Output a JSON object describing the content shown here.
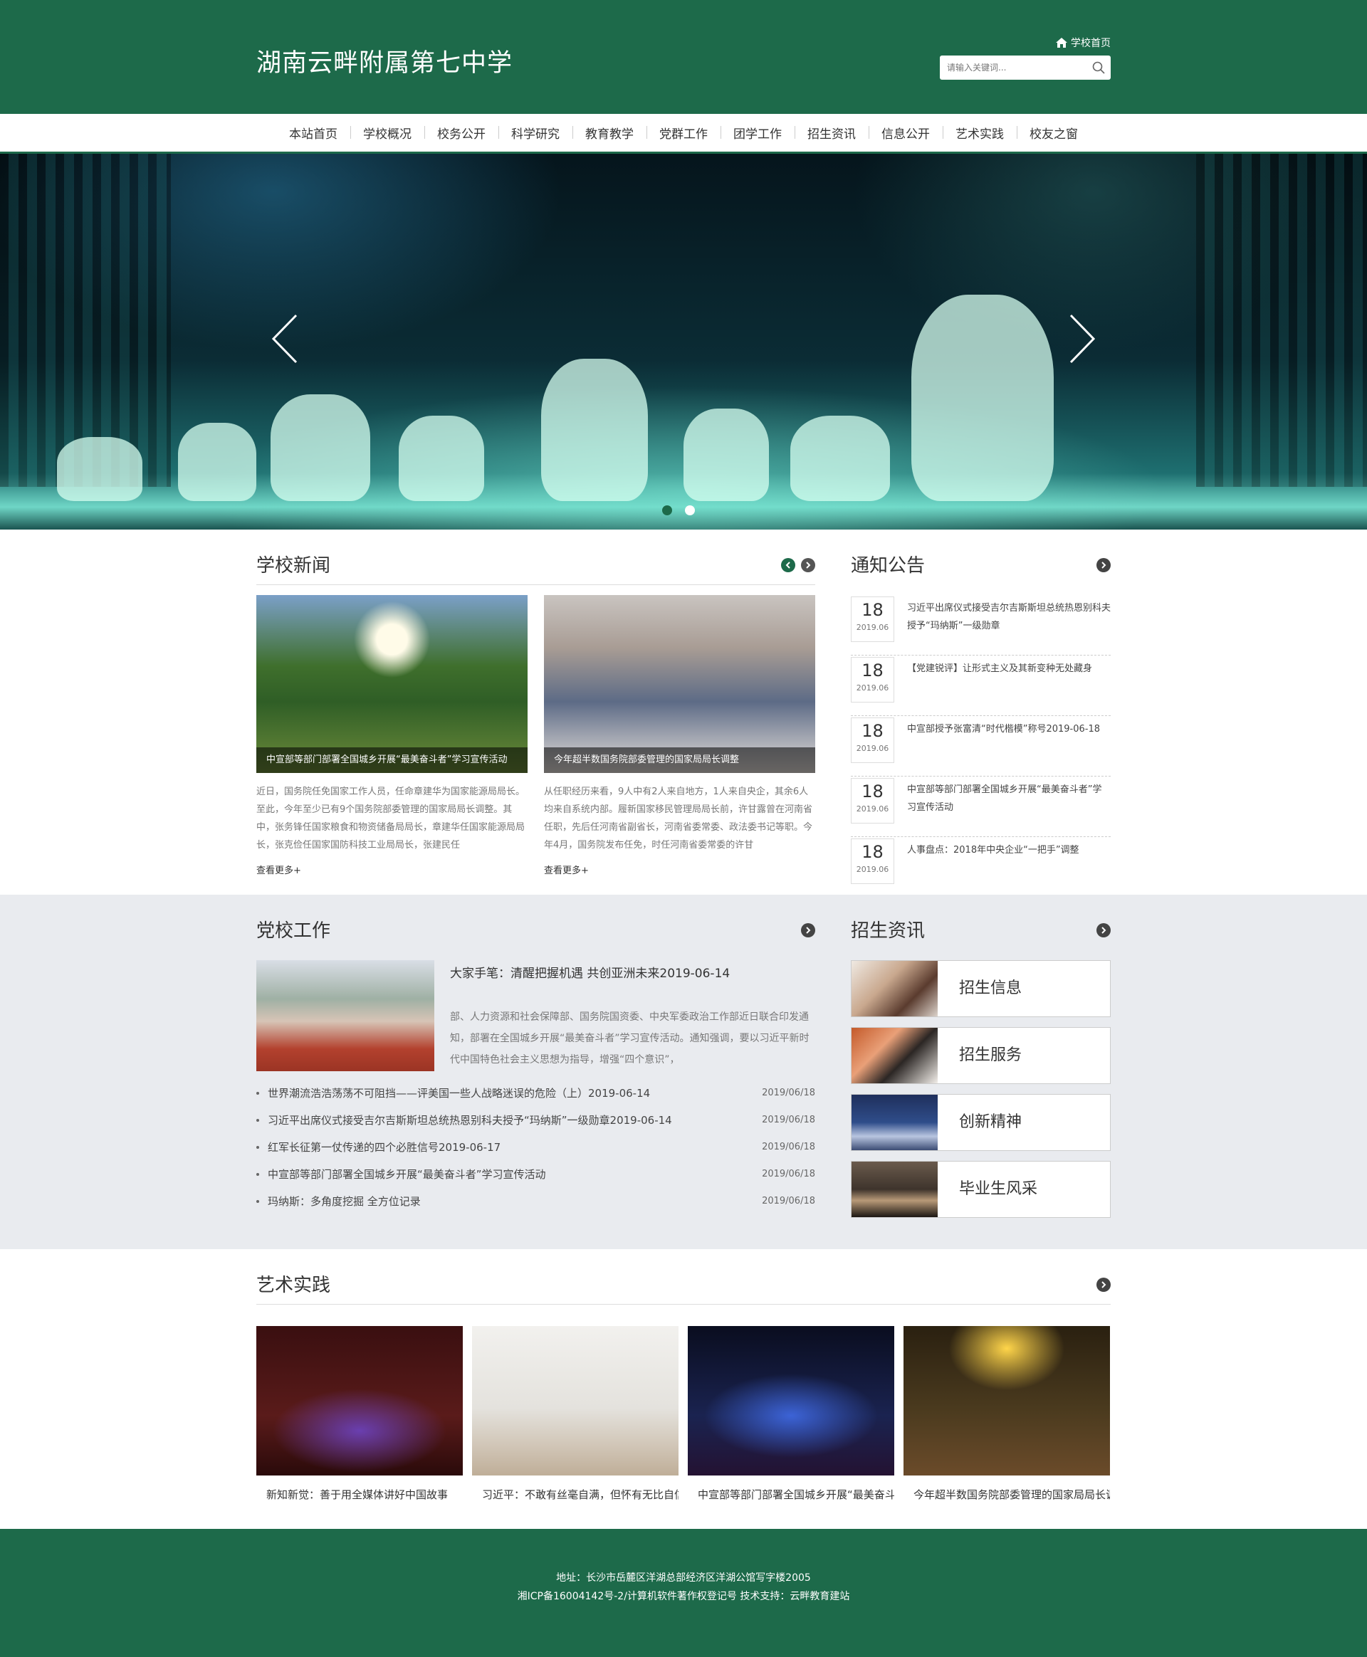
{
  "header": {
    "title": "湖南云畔附属第七中学",
    "home_link": "学校首页",
    "search_placeholder": "请输入关键词..."
  },
  "nav": {
    "items": [
      "本站首页",
      "学校概况",
      "校务公开",
      "科学研究",
      "教育教学",
      "党群工作",
      "团学工作",
      "招生资讯",
      "信息公开",
      "艺术实践",
      "校友之窗"
    ]
  },
  "school_news": {
    "title": "学校新闻",
    "cards": [
      {
        "caption": "中宣部等部门部署全国城乡开展“最美奋斗者”学习宣传活动",
        "desc": "近日，国务院任免国家工作人员，任命章建华为国家能源局局长。至此，今年至少已有9个国务院部委管理的国家局局长调整。其中，张务锋任国家粮食和物资储备局局长，章建华任国家能源局局长，张克俭任国家国防科技工业局局长，张建民任",
        "more": "查看更多+"
      },
      {
        "caption": "今年超半数国务院部委管理的国家局局长调整",
        "desc": "从任职经历来看，9人中有2人来自地方，1人来自央企，其余6人均来自系统内部。履新国家移民管理局局长前，许甘露曾在河南省任职，先后任河南省副省长，河南省委常委、政法委书记等职。今年4月，国务院发布任免，时任河南省委常委的许甘",
        "more": "查看更多+"
      }
    ]
  },
  "notices": {
    "title": "通知公告",
    "items": [
      {
        "day": "18",
        "ym": "2019.06",
        "text": "习近平出席仪式接受吉尔吉斯斯坦总统热恩别科夫授予“玛纳斯”一级勋章"
      },
      {
        "day": "18",
        "ym": "2019.06",
        "text": "【党建锐评】让形式主义及其新变种无处藏身"
      },
      {
        "day": "18",
        "ym": "2019.06",
        "text": "中宣部授予张富清“时代楷模”称号2019-06-18"
      },
      {
        "day": "18",
        "ym": "2019.06",
        "text": "中宣部等部门部署全国城乡开展“最美奋斗者”学习宣传活动"
      },
      {
        "day": "18",
        "ym": "2019.06",
        "text": "人事盘点：2018年中央企业“一把手”调整"
      }
    ]
  },
  "party": {
    "title": "党校工作",
    "feature": {
      "title": "大家手笔：清醒把握机遇 共创亚洲未来2019-06-14",
      "desc": "部、人力资源和社会保障部、国务院国资委、中央军委政治工作部近日联合印发通知，部署在全国城乡开展“最美奋斗者”学习宣传活动。通知强调，要以习近平新时代中国特色社会主义思想为指导，增强“四个意识”，"
    },
    "list": [
      {
        "title": "世界潮流浩浩荡荡不可阻挡——评美国一些人战略迷误的危险（上）2019-06-14",
        "date": "2019/06/18"
      },
      {
        "title": "习近平出席仪式接受吉尔吉斯斯坦总统热恩别科夫授予“玛纳斯”一级勋章2019-06-14",
        "date": "2019/06/18"
      },
      {
        "title": "红军长征第一仗传递的四个必胜信号2019-06-17",
        "date": "2019/06/18"
      },
      {
        "title": "中宣部等部门部署全国城乡开展“最美奋斗者”学习宣传活动",
        "date": "2019/06/18"
      },
      {
        "title": "玛纳斯：多角度挖掘 全方位记录",
        "date": "2019/06/18"
      }
    ]
  },
  "enrollment": {
    "title": "招生资讯",
    "items": [
      "招生信息",
      "招生服务",
      "创新精神",
      "毕业生风采"
    ]
  },
  "art": {
    "title": "艺术实践",
    "items": [
      "新知新觉：善于用全媒体讲好中国故事",
      "习近平：不敢有丝毫自满，但怀有无比自信",
      "中宣部等部门部署全国城乡开展“最美奋斗者”学习宣传活动",
      "今年超半数国务院部委管理的国家局局长调整"
    ]
  },
  "footer": {
    "address": "地址：长沙市岳麓区洋湖总部经济区洋湖公馆写字楼2005",
    "icp": "湘ICP备16004142号-2/计算机软件著作权登记号 技术支持：云畔教育建站"
  },
  "colors": {
    "brand": "#1d6a4a",
    "gray_bg": "#e9ebef"
  }
}
